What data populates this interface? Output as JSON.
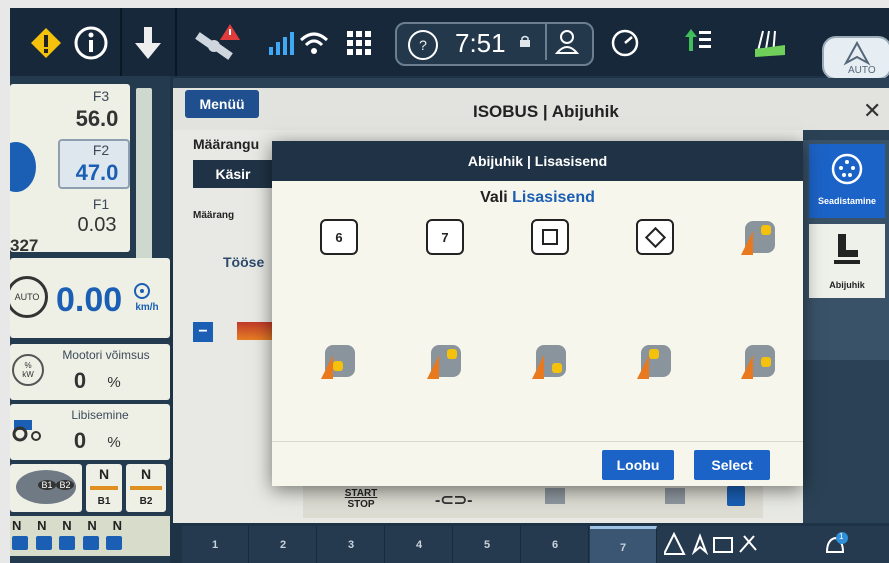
{
  "topbar": {
    "clock": "7:51",
    "help_symbol": "?",
    "auto_label": "AUTO",
    "icons": [
      "warning-icon",
      "info-icon",
      "download-arrow-icon",
      "satellite-icon",
      "signal-icon",
      "wifi-icon",
      "grid-menu-icon",
      "help-icon",
      "lock-icon",
      "user-icon",
      "speedometer-icon",
      "arrow-list-icon",
      "field-icon",
      "auto-steer-icon"
    ]
  },
  "left": {
    "f3_label": "F3",
    "f3_value": "56.0",
    "f2_label": "F2",
    "f2_value": "47.0",
    "f1_label": "F1",
    "f1_value": "0.03",
    "partial_value": "327",
    "auto_label": "AUTO",
    "speed_value": "0.00",
    "speed_unit": "km/h",
    "engine_label": "Mootori võimsus",
    "engine_unit_icon": "%\nkW",
    "engine_value": "0",
    "engine_unit": "%",
    "slip_label": "Libisemine",
    "slip_value": "0",
    "slip_unit": "%",
    "gear_b1": "B1",
    "gear_b2": "B2",
    "n_label1": "N",
    "n_label2": "N",
    "n_b1": "B1",
    "n_b2": "B2",
    "n_row": [
      "N",
      "N",
      "N",
      "N",
      "N"
    ]
  },
  "main": {
    "menu_label": "Menüü",
    "title": "ISOBUS | Abijuhik",
    "section_label": "Määrangu",
    "button_label": "Käsir",
    "lock_label": "Määrang",
    "work_label": "Tööse",
    "minus_label": "−",
    "start_stop_line1": "START",
    "start_stop_line2": "STOP",
    "right_items": [
      {
        "label": "Seadistamine"
      },
      {
        "label": "Abijuhik"
      }
    ]
  },
  "modal": {
    "title": "Abijuhik | Lisasisend",
    "prompt_prefix": "Vali ",
    "prompt_accent": "Lisasisend",
    "options": [
      {
        "type": "key",
        "text": "6"
      },
      {
        "type": "key",
        "text": "7"
      },
      {
        "type": "square"
      },
      {
        "type": "diamond"
      },
      {
        "type": "joystick"
      },
      {
        "type": "joystick"
      },
      {
        "type": "joystick"
      },
      {
        "type": "joystick"
      },
      {
        "type": "joystick"
      },
      {
        "type": "joystick"
      }
    ],
    "cancel_label": "Loobu",
    "select_label": "Select"
  },
  "bottom": {
    "pages": [
      "1",
      "2",
      "3",
      "4",
      "5",
      "6",
      "7"
    ],
    "active_page": "7",
    "notification_count": "1"
  },
  "colors": {
    "accent": "#1c63c7",
    "header": "#203346",
    "yellow_warning": "#f4c20d",
    "speed_blue": "#1a5fb4"
  }
}
